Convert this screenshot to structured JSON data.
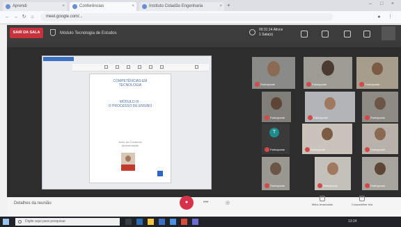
{
  "browser": {
    "tabs": [
      {
        "label": "Aprendi"
      },
      {
        "label": "Conferências"
      },
      {
        "label": "Instituto Cidadão Engenharia"
      }
    ],
    "url": "meet.google.com/..."
  },
  "meeting": {
    "leave_label": "SAIR DA SALA",
    "title": "Módulo Tecnologia de Estudos",
    "timer": {
      "line1": "00:31:14 Ativos",
      "line2": "1 Sala(s)"
    }
  },
  "shared_doc": {
    "title_lines": [
      "COMPETÊNCIAS EM",
      "TECNOLOGIA"
    ],
    "subtitle_lines": [
      "MÓDULO III -",
      "O PROCESSO DE ENSINO"
    ],
    "small_lines": [
      "Autor do Conteúdo",
      "Apresentação"
    ]
  },
  "participants": [
    {
      "name": "Participante"
    },
    {
      "name": "Participante"
    },
    {
      "name": "Participante"
    },
    {
      "name": "Participante"
    },
    {
      "name": "Participante"
    },
    {
      "name": "Participante"
    },
    {
      "name": "Participante"
    },
    {
      "name": "Participante"
    },
    {
      "name": "Participante"
    },
    {
      "name": "Participante"
    },
    {
      "name": "Participante"
    },
    {
      "name": "Participante"
    },
    {
      "name": "Participante"
    }
  ],
  "avatar_initial": "T",
  "bottom": {
    "left_label": "Detalhes da reunião",
    "side_buttons": [
      {
        "label": "Mãos levantadas"
      },
      {
        "label": "Compartilhar tela"
      }
    ]
  },
  "taskbar": {
    "search_placeholder": "Digite aqui para pesquisar",
    "tray_text": "13:24"
  },
  "colors": {
    "leave": "#c8323c",
    "record": "#d6334a",
    "accent": "#3b6fc1"
  }
}
